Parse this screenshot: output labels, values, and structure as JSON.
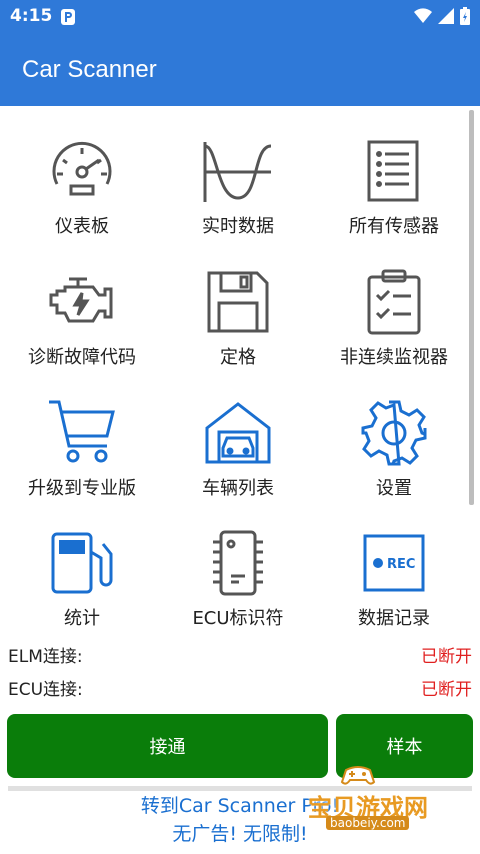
{
  "status_bar": {
    "time": "4:15"
  },
  "app_bar": {
    "title": "Car Scanner"
  },
  "tiles": [
    {
      "label": "仪表板",
      "icon": "gauge-icon"
    },
    {
      "label": "实时数据",
      "icon": "sine-wave-icon"
    },
    {
      "label": "所有传感器",
      "icon": "list-document-icon"
    },
    {
      "label": "诊断故障代码",
      "icon": "engine-warning-icon"
    },
    {
      "label": "定格",
      "icon": "floppy-disk-icon"
    },
    {
      "label": "非连续监视器",
      "icon": "clipboard-check-icon"
    },
    {
      "label": "升级到专业版",
      "icon": "shopping-cart-icon"
    },
    {
      "label": "车辆列表",
      "icon": "garage-car-icon"
    },
    {
      "label": "设置",
      "icon": "gear-icon"
    },
    {
      "label": "统计",
      "icon": "fuel-pump-icon"
    },
    {
      "label": "ECU标识符",
      "icon": "chip-icon"
    },
    {
      "label": "数据记录",
      "icon": "rec-icon"
    }
  ],
  "connection": {
    "elm_label": "ELM连接:",
    "elm_status": "已断开",
    "ecu_label": "ECU连接:",
    "ecu_status": "已断开"
  },
  "buttons": {
    "connect": "接通",
    "sample": "样本"
  },
  "promo": {
    "line1": "转到Car Scanner Pro!",
    "line2": "无广告! 无限制!"
  },
  "watermark": {
    "title": "宝贝游戏网",
    "url": "baobeiy.com"
  },
  "colors": {
    "primary": "#2f79d8",
    "accent_blue": "#1a6fd0",
    "button_green": "#0a7d0a",
    "disconnected_red": "#e02020",
    "icon_gray": "#555555"
  }
}
